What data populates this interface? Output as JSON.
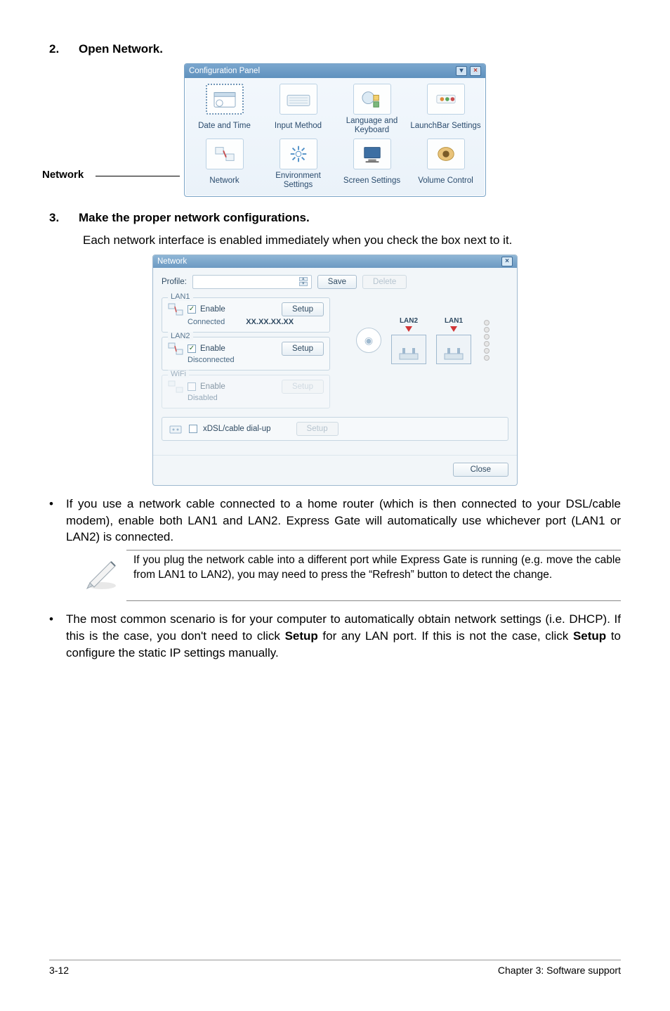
{
  "steps": {
    "s2": {
      "num": "2.",
      "title": "Open Network."
    },
    "s3": {
      "num": "3.",
      "title": "Make the proper network configurations.",
      "body": "Each network interface is enabled immediately when you check the box next to it."
    }
  },
  "callout": {
    "network": "Network"
  },
  "cfg_panel": {
    "title": "Configuration Panel",
    "items": [
      {
        "label": "Date and Time"
      },
      {
        "label": "Input Method"
      },
      {
        "label": "Language and Keyboard"
      },
      {
        "label": "LaunchBar Settings"
      },
      {
        "label": "Network"
      },
      {
        "label": "Environment Settings"
      },
      {
        "label": "Screen Settings"
      },
      {
        "label": "Volume Control"
      }
    ]
  },
  "net_win": {
    "title": "Network",
    "profile_label": "Profile:",
    "save": "Save",
    "delete": "Delete",
    "lan1": {
      "title": "LAN1",
      "enable": "Enable",
      "setup": "Setup",
      "status": "Connected",
      "ip": "XX.XX.XX.XX"
    },
    "lan2": {
      "title": "LAN2",
      "enable": "Enable",
      "setup": "Setup",
      "status": "Disconnected"
    },
    "wifi": {
      "title": "WiFi",
      "enable": "Enable",
      "setup": "Setup",
      "status": "Disabled"
    },
    "diagram": {
      "lan2": "LAN2",
      "lan1": "LAN1"
    },
    "xdsl": {
      "label": "xDSL/cable dial-up",
      "setup": "Setup"
    },
    "close": "Close"
  },
  "bullets": {
    "b1": "If you use a network cable connected to a home router (which is then connected to your DSL/cable modem), enable both LAN1 and LAN2. Express Gate  will automatically use whichever port (LAN1 or LAN2) is connected.",
    "b2_pre": "The most common scenario is for your computer to automatically obtain network settings (i.e. DHCP). If this is the case, you don't need to click ",
    "b2_bold1": "Setup",
    "b2_mid": " for any LAN port. If this is not the case, click ",
    "b2_bold2": "Setup",
    "b2_post": " to configure the static IP settings manually."
  },
  "note": "If you plug the network cable into a different port while Express Gate  is running (e.g. move the cable from LAN1 to LAN2), you may need to press the “Refresh” button to detect the change.",
  "footer": {
    "left": "3-12",
    "right": "Chapter 3: Software support"
  }
}
